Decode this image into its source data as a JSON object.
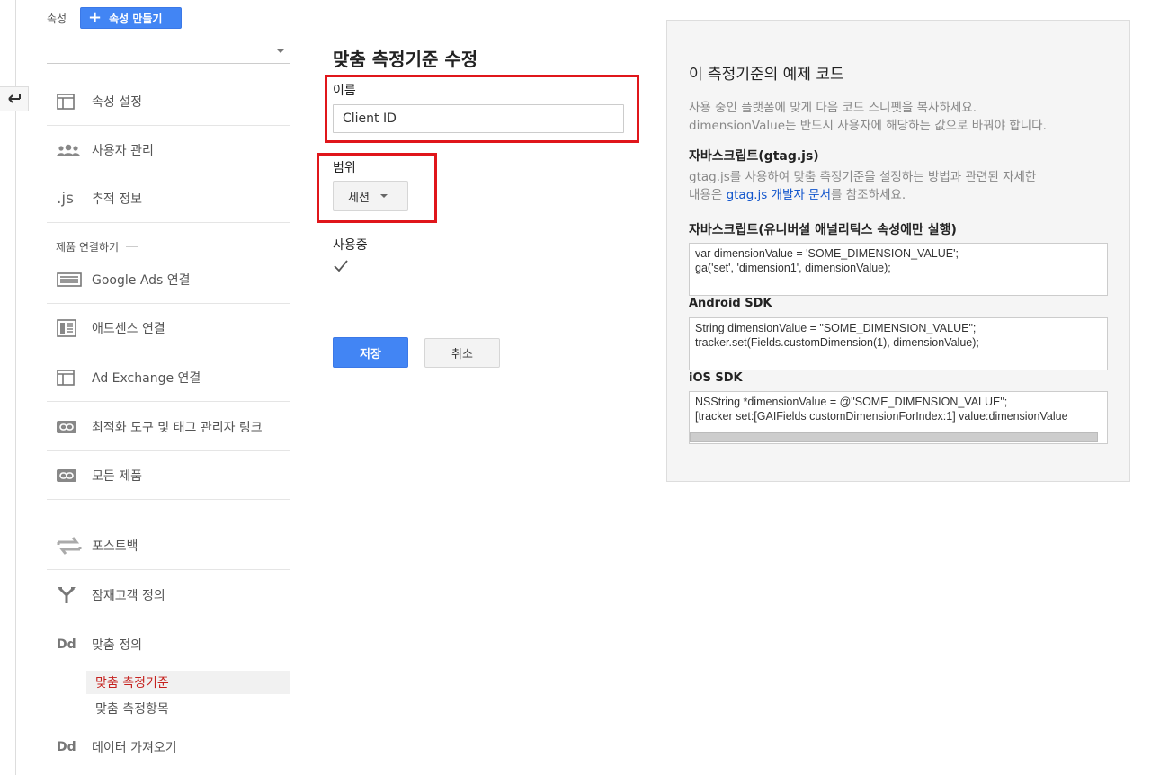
{
  "header": {
    "property_label": "속성",
    "create_property_label": "속성 만들기"
  },
  "nav": {
    "items": [
      {
        "label": "속성 설정",
        "icon": "window-icon"
      },
      {
        "label": "사용자 관리",
        "icon": "users-icon"
      },
      {
        "label": "추적 정보",
        "icon": "js-icon",
        "icon_text": ".js"
      }
    ],
    "section_label": "제품 연결하기",
    "product_items": [
      {
        "label": "Google Ads 연결",
        "icon": "ads-card-icon"
      },
      {
        "label": "애드센스 연결",
        "icon": "adsense-icon"
      },
      {
        "label": "Ad Exchange 연결",
        "icon": "window-icon"
      },
      {
        "label": "최적화 도구 및 태그 관리자 링크",
        "icon": "link-icon"
      },
      {
        "label": "모든 제품",
        "icon": "link-icon"
      }
    ],
    "other_items": [
      {
        "label": "포스트백",
        "icon": "swap-arrows-icon"
      },
      {
        "label": "잠재고객 정의",
        "icon": "fork-icon"
      },
      {
        "label": "맞춤 정의",
        "icon": "dd-icon",
        "icon_text": "Dd"
      }
    ],
    "sub_items": [
      {
        "label": "맞춤 측정기준",
        "active": true
      },
      {
        "label": "맞춤 측정항목",
        "active": false
      }
    ],
    "import_item": {
      "label": "데이터 가져오기",
      "icon": "dd-icon",
      "icon_text": "Dd"
    }
  },
  "form": {
    "title": "맞춤 측정기준 수정",
    "name_label": "이름",
    "name_value": "Client ID",
    "scope_label": "범위",
    "scope_value": "세션",
    "active_label": "사용중",
    "active_checked": true,
    "save_label": "저장",
    "cancel_label": "취소"
  },
  "code_panel": {
    "title": "이 측정기준의 예제 코드",
    "intro_line1": "사용 중인 플랫폼에 맞게 다음 코드 스니펫을 복사하세요.",
    "intro_line2": "dimensionValue는 반드시 사용자에 해당하는 값으로 바꿔야 합니다.",
    "gtag_heading": "자바스크립트(gtag.js)",
    "gtag_desc_line1": "gtag.js를 사용하여 맞춤 측정기준을 설정하는 방법과 관련된 자세한",
    "gtag_desc_pre": "내용은 ",
    "gtag_link": "gtag.js 개발자 문서",
    "gtag_desc_post": "를 참조하세요.",
    "ua_heading": "자바스크립트(유니버설 애널리틱스 속성에만 실행)",
    "ua_code": "var dimensionValue = 'SOME_DIMENSION_VALUE';\nga('set', 'dimension1', dimensionValue);",
    "android_heading": "Android SDK",
    "android_code": "String dimensionValue = \"SOME_DIMENSION_VALUE\";\ntracker.set(Fields.customDimension(1), dimensionValue);",
    "ios_heading": "iOS SDK",
    "ios_code": "NSString *dimensionValue = @\"SOME_DIMENSION_VALUE\";\n[tracker set:[GAIFields customDimensionForIndex:1] value:dimensionValue"
  },
  "colors": {
    "primary_blue": "#4285f4",
    "highlight_red": "#e0161b",
    "active_nav_red": "#c5221f",
    "link_blue": "#1155cc"
  }
}
